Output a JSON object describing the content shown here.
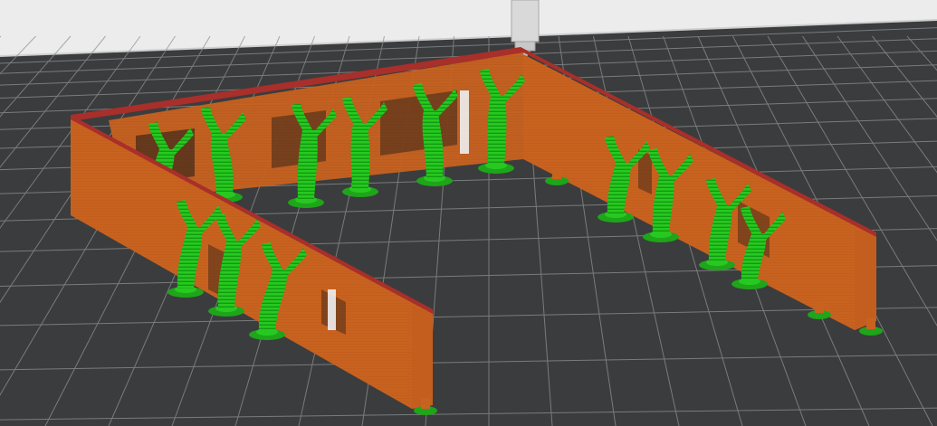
{
  "viewport": {
    "view": "3d-slice-preview",
    "colors": {
      "background_top": "#ececec",
      "bed": "#3b3c3d",
      "grid_line": "#9a9b9c",
      "wall_face": "#c8621f",
      "wall_top": "#a82f2a",
      "tree_support": "#22c51e",
      "nozzle": "#d9d9d9"
    },
    "icons": {
      "nozzle": "nozzle-icon",
      "print_object": "printed-part-walls",
      "supports": "tree-supports"
    }
  }
}
